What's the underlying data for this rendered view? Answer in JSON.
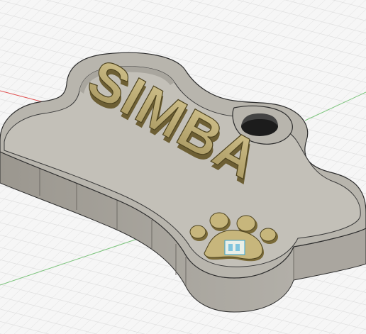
{
  "window": {
    "title": ""
  },
  "model": {
    "tag_shape": "dog-bone",
    "engraved_text": "SIMBA",
    "emblem": "paw-print",
    "colors": {
      "background": "#f6f6f6",
      "grid_line": "#d8d8d8",
      "grid_major": "#c8c8c8",
      "axis_red": "#e05050",
      "axis_green": "#7cc47c",
      "body_top": "#b9b6ae",
      "body_side": "#a6a39c",
      "body_inner": "#c4c1b9",
      "edge": "#2d2d2d",
      "gold": "#b7a56d",
      "gold_dark": "#6d5f34",
      "gold_light": "#d2c28c",
      "selection_highlight": "#3ba7d6"
    }
  }
}
